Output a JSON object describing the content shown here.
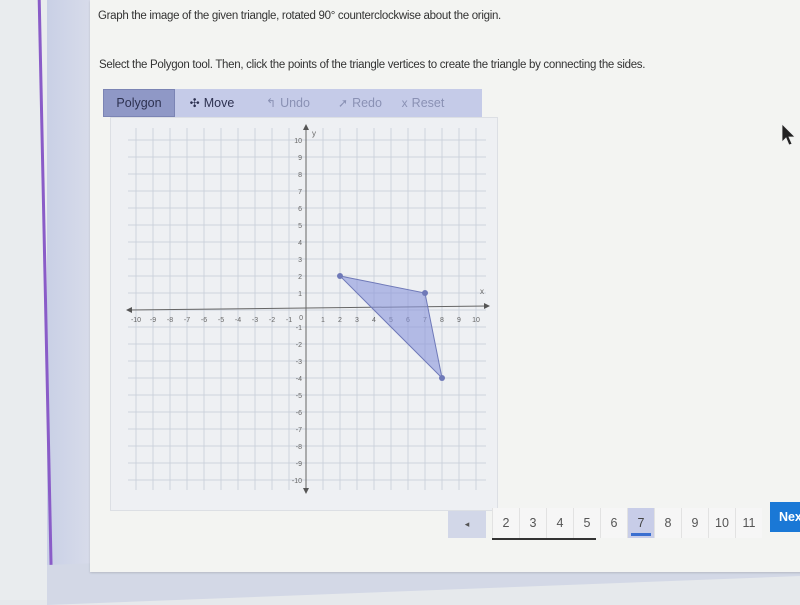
{
  "question": "Graph the image of the given triangle, rotated 90° counterclockwise about the origin.",
  "instruction": "Select the Polygon tool. Then, click the points of the triangle vertices to create the triangle by connecting the sides.",
  "toolbar": {
    "polygon_label": "Polygon",
    "move_label": "Move",
    "move_icon": "move-cross-icon",
    "undo_label": "Undo",
    "undo_icon": "undo-arrow-icon",
    "redo_label": "Redo",
    "redo_icon": "redo-arrow-icon",
    "reset_label": "Reset",
    "reset_icon": "x-icon",
    "active_tool": "Polygon"
  },
  "graph": {
    "x_axis_label": "x",
    "y_axis_label": "y",
    "x_range": [
      -10,
      10
    ],
    "y_range": [
      -10,
      10
    ],
    "x_ticks": [
      "-10",
      "-9",
      "-8",
      "-7",
      "-6",
      "-5",
      "-4",
      "-3",
      "-2",
      "-1",
      "1",
      "2",
      "3",
      "4",
      "5",
      "6",
      "7",
      "8",
      "9",
      "10"
    ],
    "y_ticks": [
      "10",
      "9",
      "8",
      "7",
      "6",
      "5",
      "4",
      "3",
      "2",
      "1",
      "-1",
      "-2",
      "-3",
      "-4",
      "-5",
      "-6",
      "-7",
      "-8",
      "-9",
      "-10"
    ],
    "origin_label": "0",
    "triangle": {
      "vertices": [
        [
          2,
          2
        ],
        [
          7,
          1
        ],
        [
          8,
          -4
        ]
      ],
      "fill": "#8a96dc",
      "stroke": "#6f79b8"
    }
  },
  "pagination": {
    "prev_icon": "left-arrow-icon",
    "pages": [
      "2",
      "3",
      "4",
      "5",
      "6",
      "7",
      "8",
      "9",
      "10",
      "11"
    ],
    "current_page": "7",
    "next_label": "Next",
    "next_icon": "right-arrow-icon"
  }
}
